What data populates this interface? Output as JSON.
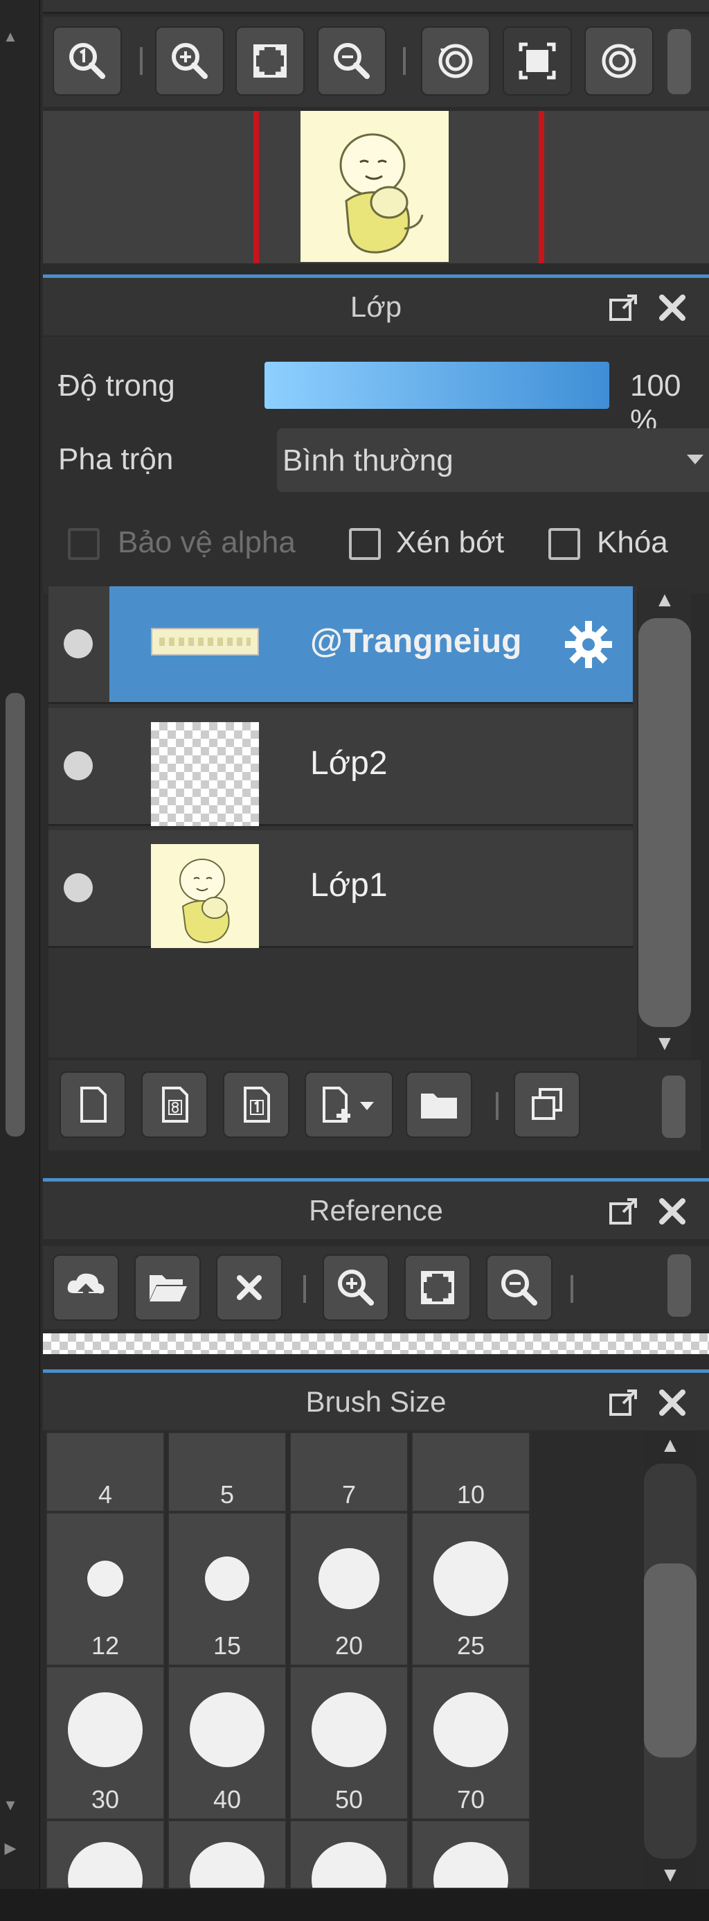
{
  "colors": {
    "accent": "#4a8fcb",
    "opacity_fill": "#5aaef0",
    "red_guide": "#c8141b",
    "panel_bg": "#2b2b2b"
  },
  "navigator": {
    "toolbar": [
      {
        "name": "zoom-actual-size",
        "icon": "zoom-1-icon"
      },
      {
        "name": "zoom-in",
        "icon": "zoom-in-icon"
      },
      {
        "name": "fit-view",
        "icon": "fit-view-icon"
      },
      {
        "name": "zoom-out",
        "icon": "zoom-out-icon"
      },
      {
        "name": "rotate-left",
        "icon": "rotate-left-icon"
      },
      {
        "name": "reset-view",
        "icon": "reset-view-icon"
      },
      {
        "name": "rotate-right",
        "icon": "rotate-right-icon"
      }
    ]
  },
  "layer_panel": {
    "title": "Lớp",
    "opacity_label": "Độ trong",
    "opacity_value": "100 %",
    "opacity_fraction": 1.0,
    "blend_label": "Pha trộn",
    "blend_value": "Bình thường",
    "protect_alpha": "Bảo vệ alpha",
    "clipping": "Xén bớt",
    "lock": "Khóa",
    "layers": [
      {
        "name": "@Trangneiug",
        "selected": true,
        "thumb": "text-strip"
      },
      {
        "name": "Lớp2",
        "selected": false,
        "thumb": "transparent"
      },
      {
        "name": "Lớp1",
        "selected": false,
        "thumb": "drawing"
      }
    ]
  },
  "reference_panel": {
    "title": "Reference"
  },
  "brush_panel": {
    "title": "Brush Size",
    "rows": [
      [
        "4",
        "5",
        "7",
        "10"
      ],
      [
        "12",
        "15",
        "20",
        "25"
      ],
      [
        "30",
        "40",
        "50",
        "70"
      ]
    ]
  }
}
